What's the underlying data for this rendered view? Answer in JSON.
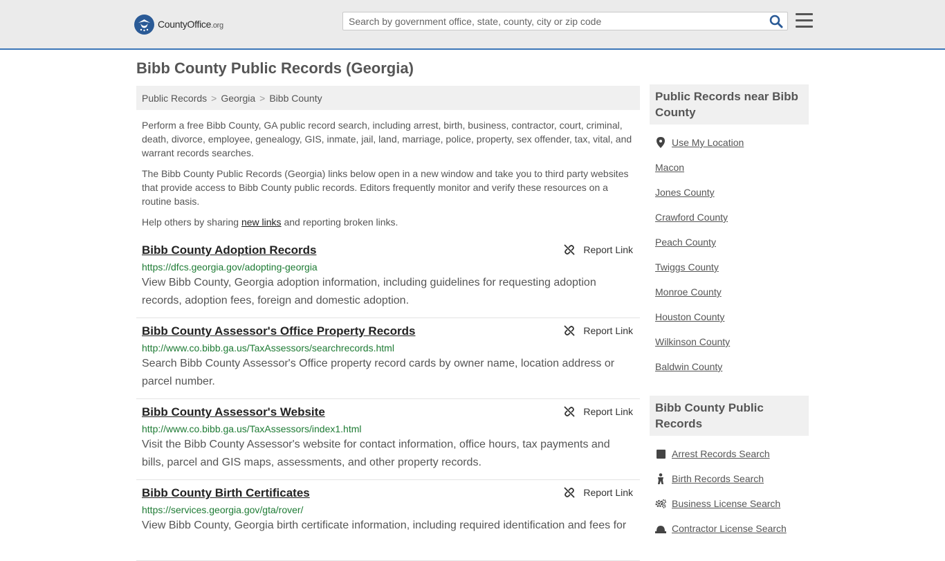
{
  "header": {
    "logo_text": "CountyOffice",
    "logo_suffix": ".org",
    "search_placeholder": "Search by government office, state, county, city or zip code"
  },
  "page_title": "Bibb County Public Records (Georgia)",
  "breadcrumb": [
    "Public Records",
    "Georgia",
    "Bibb County"
  ],
  "intro": {
    "p1": "Perform a free Bibb County, GA public record search, including arrest, birth, business, contractor, court, criminal, death, divorce, employee, genealogy, GIS, inmate, jail, land, marriage, police, property, sex offender, tax, vital, and warrant records searches.",
    "p2": "The Bibb County Public Records (Georgia) links below open in a new window and take you to third party websites that provide access to Bibb County public records. Editors frequently monitor and verify these resources on a routine basis.",
    "p3_before": "Help others by sharing ",
    "p3_link": "new links",
    "p3_after": " and reporting broken links."
  },
  "report_label": "Report Link",
  "records": [
    {
      "title": "Bibb County Adoption Records",
      "url": "https://dfcs.georgia.gov/adopting-georgia",
      "desc": "View Bibb County, Georgia adoption information, including guidelines for requesting adoption records, adoption fees, foreign and domestic adoption."
    },
    {
      "title": "Bibb County Assessor's Office Property Records",
      "url": "http://www.co.bibb.ga.us/TaxAssessors/searchrecords.html",
      "desc": "Search Bibb County Assessor's Office property record cards by owner name, location address or parcel number."
    },
    {
      "title": "Bibb County Assessor's Website",
      "url": "http://www.co.bibb.ga.us/TaxAssessors/index1.html",
      "desc": "Visit the Bibb County Assessor's website for contact information, office hours, tax payments and bills, parcel and GIS maps, assessments, and other property records."
    },
    {
      "title": "Bibb County Birth Certificates",
      "url": "https://services.georgia.gov/gta/rover/",
      "desc": "View Bibb County, Georgia birth certificate information, including required identification and fees for"
    }
  ],
  "sidebar": {
    "nearby_title": "Public Records near Bibb County",
    "use_location": "Use My Location",
    "nearby": [
      "Macon",
      "Jones County",
      "Crawford County",
      "Peach County",
      "Twiggs County",
      "Monroe County",
      "Houston County",
      "Wilkinson County",
      "Baldwin County"
    ],
    "records_title": "Bibb County Public Records",
    "record_links": [
      {
        "label": "Arrest Records Search",
        "icon": "square-icon"
      },
      {
        "label": "Birth Records Search",
        "icon": "baby-icon"
      },
      {
        "label": "Business License Search",
        "icon": "gears-icon"
      },
      {
        "label": "Contractor License Search",
        "icon": "hardhat-icon"
      }
    ]
  },
  "colors": {
    "accent": "#3c76b8",
    "url_green": "#1e7b34",
    "header_bg": "#ebebeb"
  }
}
